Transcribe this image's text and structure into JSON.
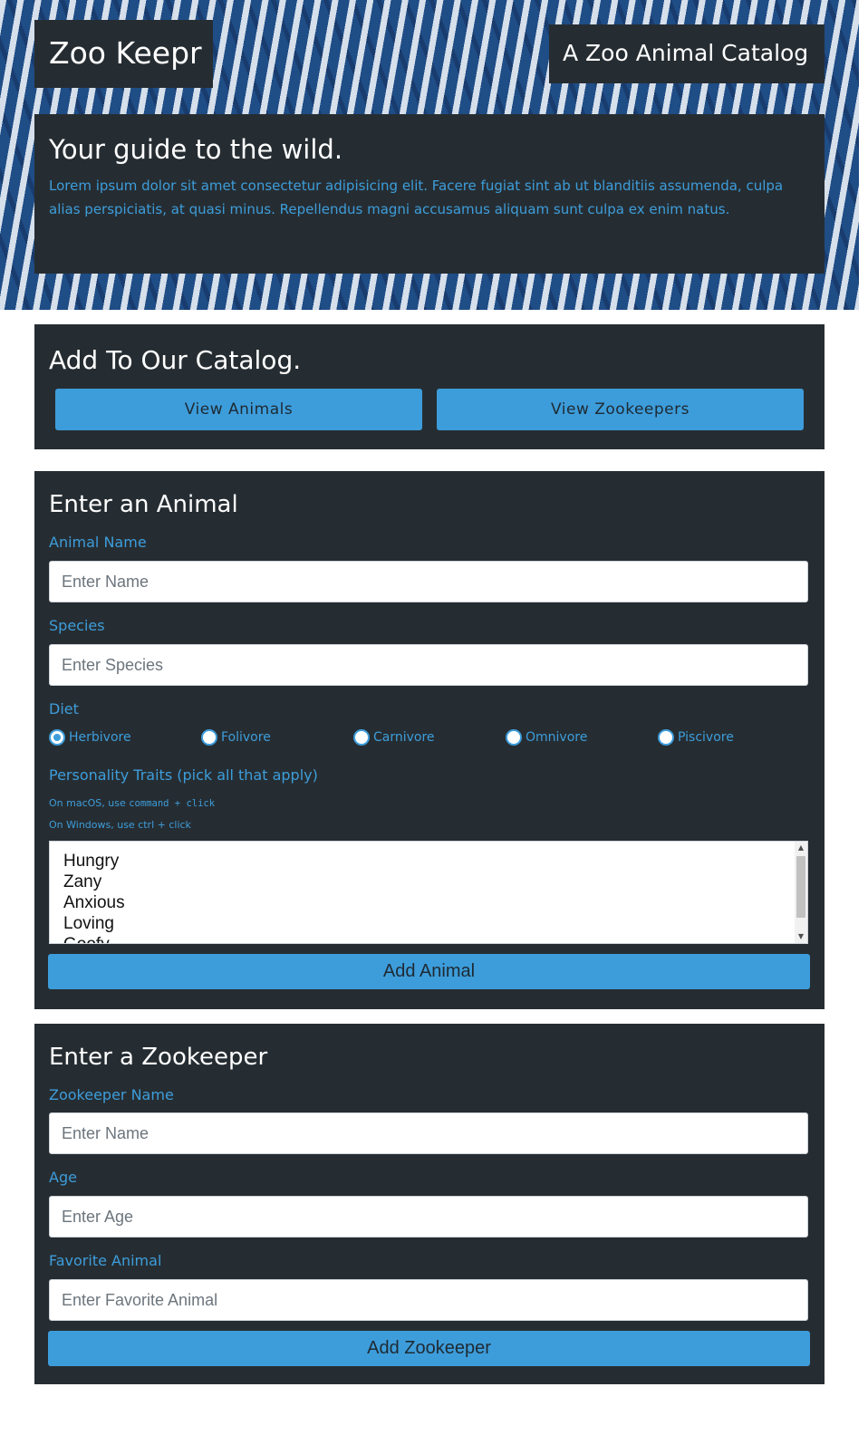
{
  "header": {
    "brand": "Zoo Keepr",
    "tagline": "A Zoo Animal Catalog",
    "intro_title": "Your guide to the wild.",
    "intro_text": "Lorem ipsum dolor sit amet consectetur adipisicing elit. Facere fugiat sint ab ut blanditiis assumenda, culpa alias perspiciatis, at quasi minus. Repellendus magni accusamus aliquam sunt culpa ex enim natus."
  },
  "catalog": {
    "title": "Add To Our Catalog.",
    "view_animals": "View Animals",
    "view_zookeepers": "View Zookeepers"
  },
  "animal_form": {
    "title": "Enter an Animal",
    "name_label": "Animal Name",
    "name_placeholder": "Enter Name",
    "species_label": "Species",
    "species_placeholder": "Enter Species",
    "diet_label": "Diet",
    "diet_options": [
      "Herbivore",
      "Folivore",
      "Carnivore",
      "Omnivore",
      "Piscivore"
    ],
    "diet_selected": "Herbivore",
    "traits_label": "Personality Traits (pick all that apply)",
    "hint_mac_prefix": "On macOS, use ",
    "hint_mac_keys": "command + click",
    "hint_windows": "On Windows, use ctrl + click",
    "traits": [
      "Hungry",
      "Zany",
      "Anxious",
      "Loving",
      "Goofy"
    ],
    "submit": "Add Animal"
  },
  "keeper_form": {
    "title": "Enter a Zookeeper",
    "name_label": "Zookeeper Name",
    "name_placeholder": "Enter Name",
    "age_label": "Age",
    "age_placeholder": "Enter Age",
    "favorite_label": "Favorite Animal",
    "favorite_placeholder": "Enter Favorite Animal",
    "submit": "Add Zookeeper"
  },
  "colors": {
    "panel": "#262d32",
    "accent": "#3d9ddb",
    "hero": "#1f4d86"
  }
}
